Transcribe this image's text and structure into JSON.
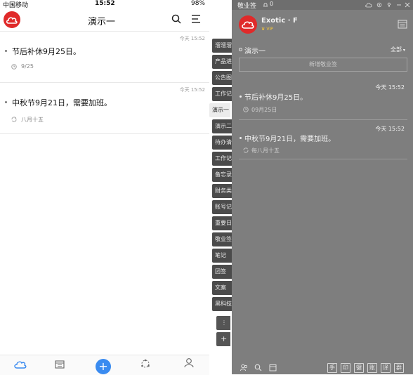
{
  "status_bar": {
    "carrier": "中国移动",
    "time": "15:52",
    "battery": "98%"
  },
  "header": {
    "title": "演示一"
  },
  "notes": [
    {
      "timestamp": "今天 15:52",
      "text": "节后补休9月25日。",
      "date": "9/25",
      "panel_date": "09月25日"
    },
    {
      "timestamp": "今天 15:52",
      "text": "中秋节9月21日，需要加班。",
      "date": "八月十五",
      "panel_date": "每八月十五"
    }
  ],
  "side_tabs": [
    {
      "label": "溜溜溜"
    },
    {
      "label": "产品进"
    },
    {
      "label": "公告图"
    },
    {
      "label": "工作记"
    },
    {
      "label": "演示一"
    },
    {
      "label": "演示二"
    },
    {
      "label": "待办清"
    },
    {
      "label": "工作记"
    },
    {
      "label": "备忘录"
    },
    {
      "label": "财务类"
    },
    {
      "label": "账号记"
    },
    {
      "label": "重要日"
    },
    {
      "label": "敬业签"
    },
    {
      "label": "笔记"
    },
    {
      "label": "团签"
    },
    {
      "label": "文案"
    },
    {
      "label": "黑科技"
    }
  ],
  "side_more": "⋮",
  "side_add": "+",
  "tabbar": {
    "items": [
      {
        "label": "敬业签"
      },
      {
        "label": "日历"
      },
      {
        "label": ""
      },
      {
        "label": "团签"
      },
      {
        "label": "我的"
      }
    ]
  },
  "panel": {
    "app_name": "敬业签",
    "notif_count": "0",
    "user": {
      "name": "Exotic · F",
      "badge": "VIP"
    },
    "category": "演示一",
    "filter": "全部",
    "add_label": "新增敬业签",
    "footer_buttons": [
      "手",
      "印",
      "键",
      "账",
      "译",
      "群"
    ]
  }
}
